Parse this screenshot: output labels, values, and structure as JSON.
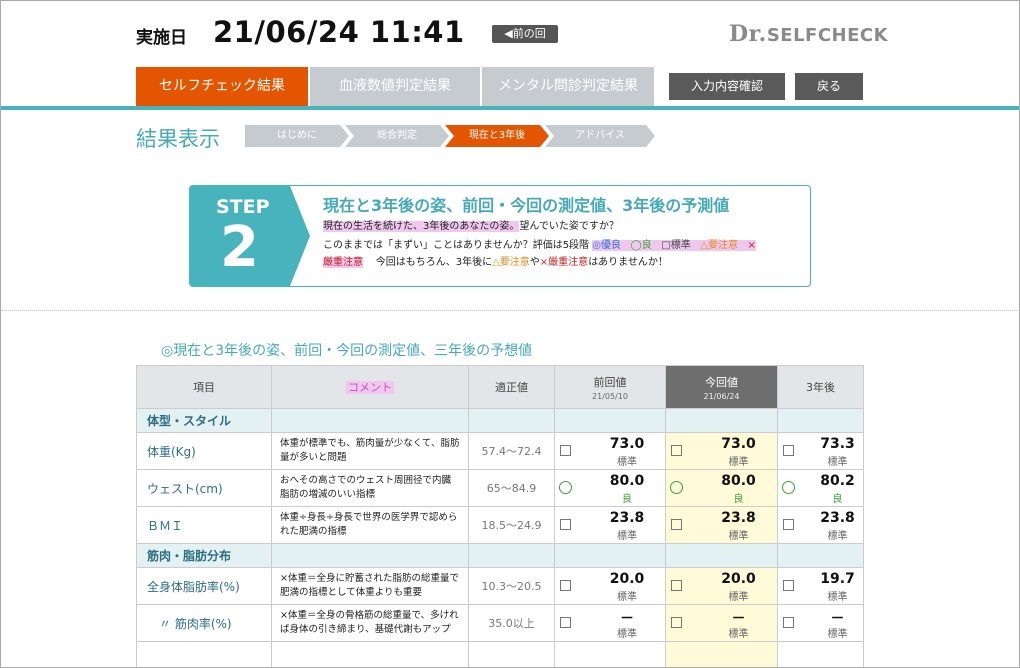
{
  "header": {
    "date_label": "実施日",
    "date_value": "21/06/24 11:41",
    "prev_button": "◀前の回",
    "logo_prefix": "Dr.",
    "logo_rest": "SELFCHECK"
  },
  "tabs": [
    {
      "label": "セルフチェック結果",
      "active": true
    },
    {
      "label": "血液数値判定結果",
      "active": false
    },
    {
      "label": "メンタル問診判定結果",
      "active": false
    }
  ],
  "actions": {
    "confirm": "入力内容確認",
    "back": "戻る"
  },
  "result": {
    "title": "結果表示",
    "crumbs": [
      "はじめに",
      "総合判定",
      "現在と3年後",
      "アドバイス"
    ],
    "active_crumb": 2
  },
  "step": {
    "word": "STEP",
    "number": "2",
    "heading": "現在と3年後の姿、前回・今回の測定値、3年後の予測値",
    "line1_hl": "現在の生活を続けた、3年後のあなたの姿。",
    "line1_rest": "望んでいた姿ですか？",
    "line2_a": "このままでは「まずい」ことはありませんか？評価は5段階",
    "legend_excellent": "◎優良",
    "legend_good": "◯良",
    "legend_standard": "□標準",
    "legend_caution": "△要注意",
    "legend_strict_mark": "×",
    "legend_strict": "厳重注意",
    "line3_a": "今回はもちろん、3年後に",
    "line3_caution": "△要注意",
    "line3_mid": "や",
    "line3_strict": "×厳重注意",
    "line3_end": "はありませんか！"
  },
  "table": {
    "caption": "◎現在と3年後の姿、前回・今回の測定値、三年後の予想値",
    "headers": {
      "item": "項目",
      "comment": "コメント",
      "range": "適正値",
      "prev": "前回値",
      "prev_date": "21/05/10",
      "now": "今回値",
      "now_date": "21/06/24",
      "future": "3年後"
    },
    "categories": {
      "body": "体型・スタイル",
      "muscle": "筋肉・脂肪分布"
    },
    "rows": [
      {
        "item": "体重(Kg)",
        "comment": "体重が標準でも、筋肉量が少なくて、脂肪量が多いと問題",
        "range": "57.4～72.4",
        "prev": {
          "value": "73.0",
          "eval": "標準"
        },
        "now": {
          "value": "73.0",
          "eval": "標準"
        },
        "future": {
          "value": "73.3",
          "eval": "標準"
        }
      },
      {
        "item": "ウェスト(cm)",
        "comment": "おへその高さでのウェスト周囲径で内臓脂肪の増減のいい指標",
        "range": "65～84.9",
        "prev": {
          "value": "80.0",
          "eval": "良"
        },
        "now": {
          "value": "80.0",
          "eval": "良"
        },
        "future": {
          "value": "80.2",
          "eval": "良"
        }
      },
      {
        "item": "ＢＭＩ",
        "comment": "体重÷身長÷身長で世界の医学界で認められた肥満の指標",
        "range": "18.5～24.9",
        "prev": {
          "value": "23.8",
          "eval": "標準"
        },
        "now": {
          "value": "23.8",
          "eval": "標準"
        },
        "future": {
          "value": "23.8",
          "eval": "標準"
        }
      },
      {
        "item": "全身体脂肪率(%)",
        "comment": "×体重＝全身に貯蓄された脂肪の総重量で肥満の指標として体重よりも重要",
        "range": "10.3～20.5",
        "prev": {
          "value": "20.0",
          "eval": "標準"
        },
        "now": {
          "value": "20.0",
          "eval": "標準"
        },
        "future": {
          "value": "19.7",
          "eval": "標準"
        }
      },
      {
        "item": "〃 筋肉率(%)",
        "comment": "×体重＝全身の骨格筋の総重量で、多ければ身体の引き締まり、基礎代謝もアップ",
        "range": "35.0以上",
        "prev": {
          "value": "－",
          "eval": "標準"
        },
        "now": {
          "value": "－",
          "eval": "標準"
        },
        "future": {
          "value": "－",
          "eval": "標準"
        }
      }
    ]
  },
  "colors": {
    "accent": "#e45500",
    "teal": "#46b3bd",
    "tab_inactive": "#c6cbd0",
    "now_column": "#fffbd8"
  }
}
